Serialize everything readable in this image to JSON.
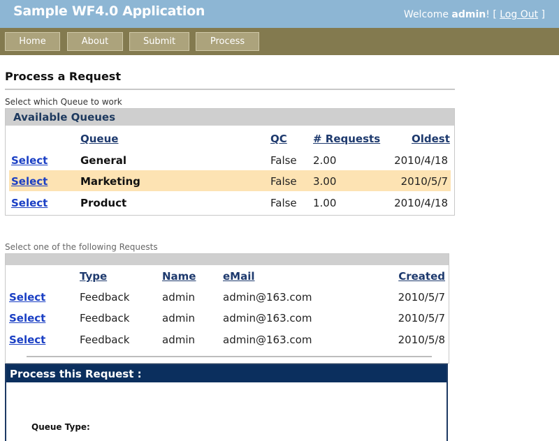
{
  "header": {
    "app_title": "Sample WF4.0 Application",
    "welcome_prefix": "Welcome ",
    "username": "admin",
    "welcome_suffix": "! [ ",
    "logout_label": "Log Out",
    "logout_suffix": " ]"
  },
  "nav": {
    "items": [
      {
        "label": "Home"
      },
      {
        "label": "About"
      },
      {
        "label": "Submit"
      },
      {
        "label": "Process"
      }
    ]
  },
  "page": {
    "title": "Process a Request",
    "queue_caption": "Select which Queue to work",
    "requests_caption": "Select one of the following Requests"
  },
  "queues": {
    "panel_title": "Available Queues",
    "columns": {
      "queue": "Queue",
      "qc": "QC",
      "requests": "# Requests",
      "oldest": "Oldest"
    },
    "rows": [
      {
        "action": "Select",
        "queue": "General",
        "qc": "False",
        "requests": "2.00",
        "oldest": "2010/4/18"
      },
      {
        "action": "Select",
        "queue": "Marketing",
        "qc": "False",
        "requests": "3.00",
        "oldest": "2010/5/7"
      },
      {
        "action": "Select",
        "queue": "Product",
        "qc": "False",
        "requests": "1.00",
        "oldest": "2010/4/18"
      }
    ],
    "selected_index": 1,
    "highlight_color": "#fde3b3"
  },
  "requests": {
    "columns": {
      "type": "Type",
      "name": "Name",
      "email": "eMail",
      "created": "Created"
    },
    "rows": [
      {
        "action": "Select",
        "type": "Feedback",
        "name": "admin",
        "email": "admin@163.com",
        "created": "2010/5/7"
      },
      {
        "action": "Select",
        "type": "Feedback",
        "name": "admin",
        "email": "admin@163.com",
        "created": "2010/5/7"
      },
      {
        "action": "Select",
        "type": "Feedback",
        "name": "admin",
        "email": "admin@163.com",
        "created": "2010/5/8"
      }
    ]
  },
  "process": {
    "panel_title": "Process this Request :",
    "queue_type_label": "Queue Type:"
  },
  "colors": {
    "header_bg": "#8db6d4",
    "nav_bg": "#837a4f",
    "nav_button": "#aca37c",
    "process_header": "#0b2f5e",
    "link": "#1a3fc4"
  }
}
